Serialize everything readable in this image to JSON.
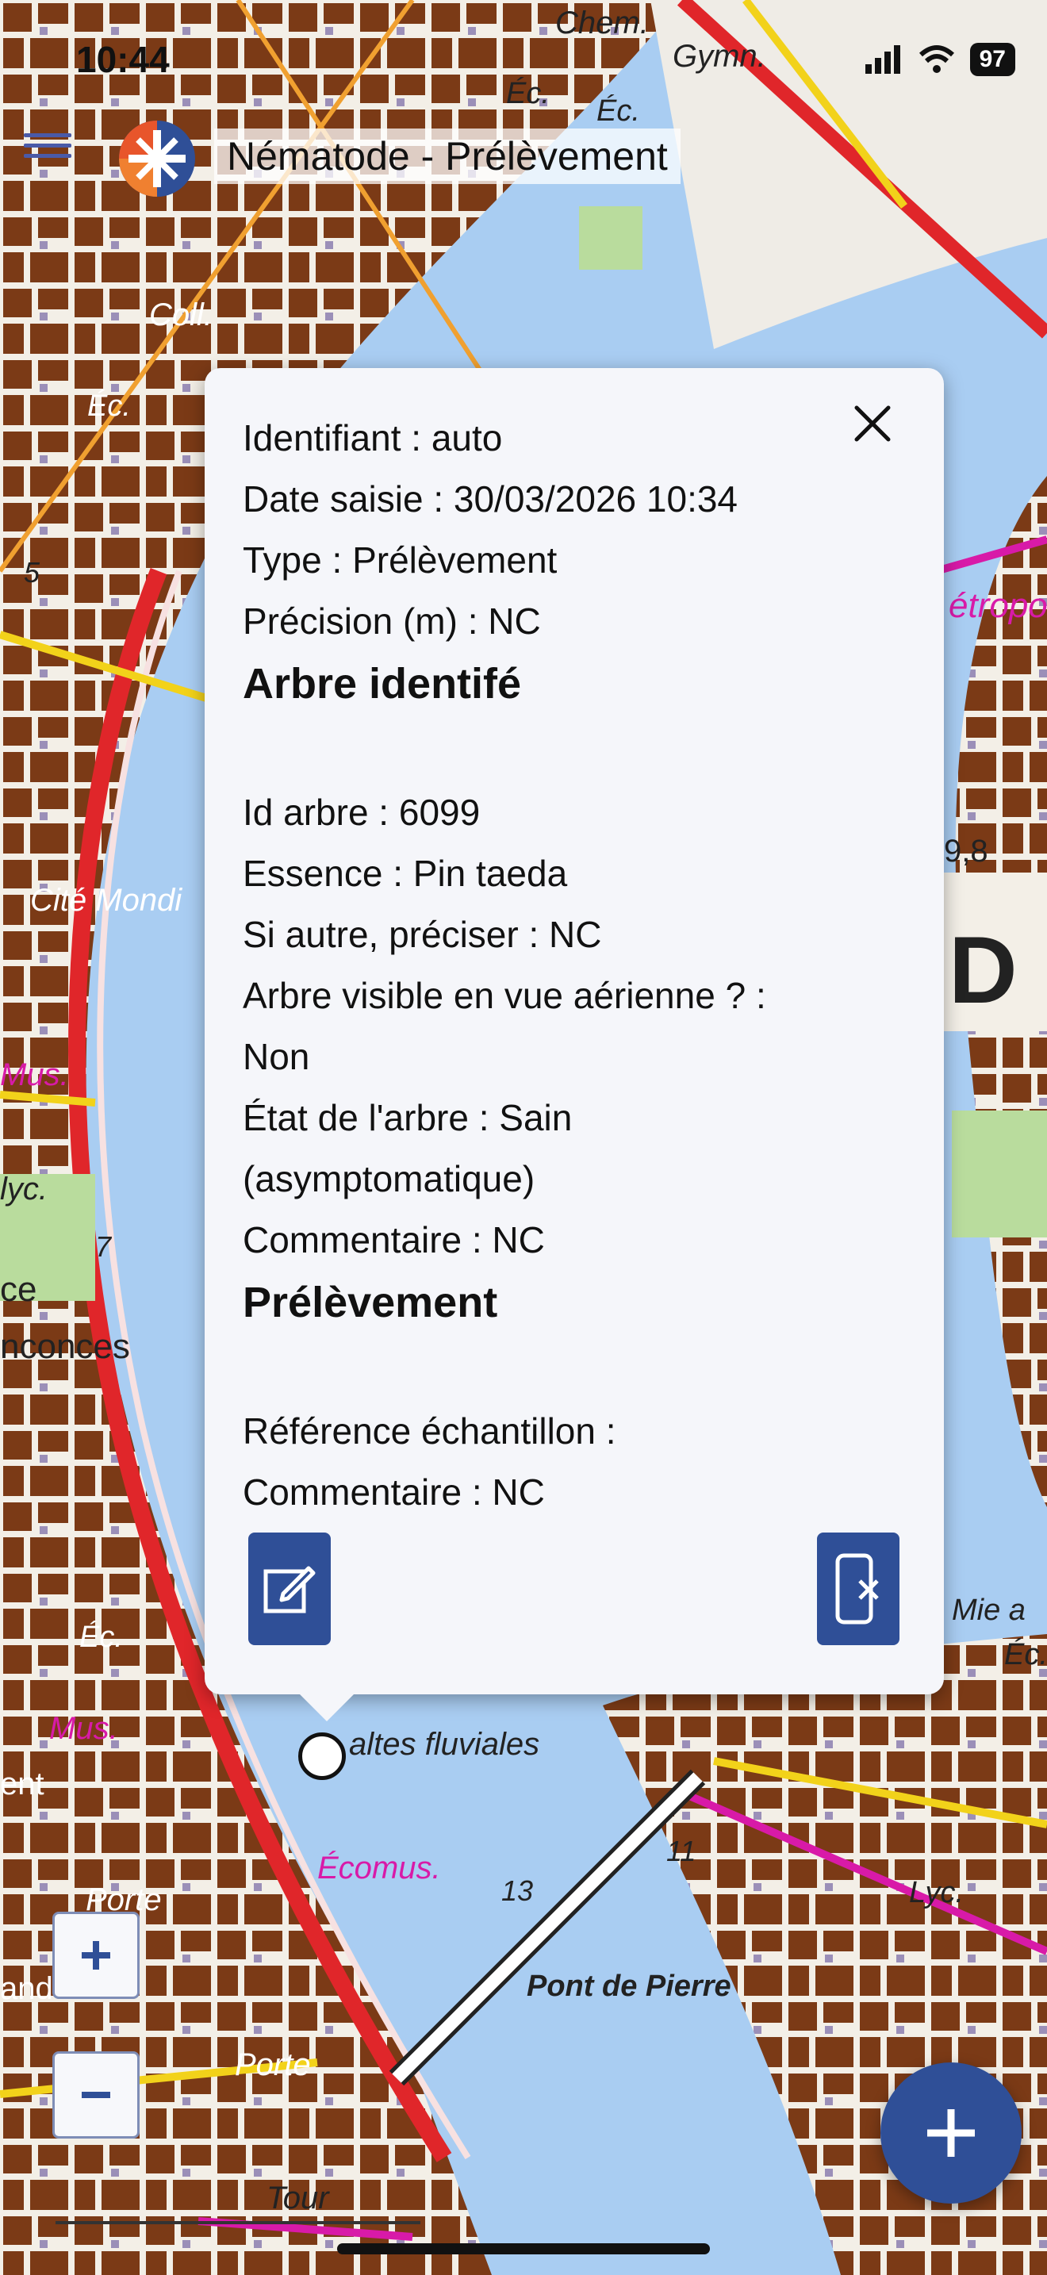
{
  "status": {
    "time": "10:44",
    "battery": "97"
  },
  "header": {
    "title": "Nématode - Prélèvement"
  },
  "popup": {
    "fields": [
      "Identifiant : auto",
      "Date saisie : 30/03/2026 10:34",
      "Type : Prélèvement",
      "Précision (m) : NC"
    ],
    "section1_title": "Arbre identifé",
    "section1_fields": [
      "Id arbre : 6099",
      "Essence : Pin taeda",
      "Si autre, préciser : NC",
      "Arbre visible en vue aérienne ? :",
      "Non",
      "État de l'arbre : Sain",
      "(asymptomatique)",
      "Commentaire : NC"
    ],
    "section2_title": "Prélèvement",
    "section2_fields": [
      "Référence échantillon :",
      "Commentaire : NC"
    ]
  },
  "map_labels": {
    "chem": "Chem.",
    "gymn": "Gymn.",
    "ec1": "Éc.",
    "ec2": "Éc.",
    "coll": "Coll.",
    "ec3": "Éc.",
    "cite": "Cité Mondi",
    "mus1": "Mus.",
    "lyc1": "lyc.",
    "ce": "ce",
    "nconces": "nconces",
    "ec4": "Éc.",
    "mus2": "Mus.",
    "ent": "ent",
    "haltes": "altes fluviales",
    "ecomus": "Écomus.",
    "num13": "13",
    "num11": "11",
    "porte1": "Porte",
    "and": "and",
    "pont": "Pont de Pierre",
    "lyc2": "Lyc.",
    "mie": "Mie a",
    "ec5": "Éc.",
    "porte2": "Porte",
    "tour": "Tour",
    "num98": "9,8",
    "d": "D",
    "etropo": "étropo",
    "num5": "5",
    "num7": "7"
  },
  "colors": {
    "water": "#a9cdf2",
    "buildings": "#7b3a16",
    "accent": "#2f4f97",
    "road_red": "#e0262a",
    "road_yellow": "#f2d21a",
    "road_magenta": "#d81aa8"
  },
  "icons": {
    "menu": "hamburger-icon",
    "close": "close-icon",
    "edit": "edit-icon",
    "delete": "phone-delete-icon",
    "add": "plus-icon"
  }
}
